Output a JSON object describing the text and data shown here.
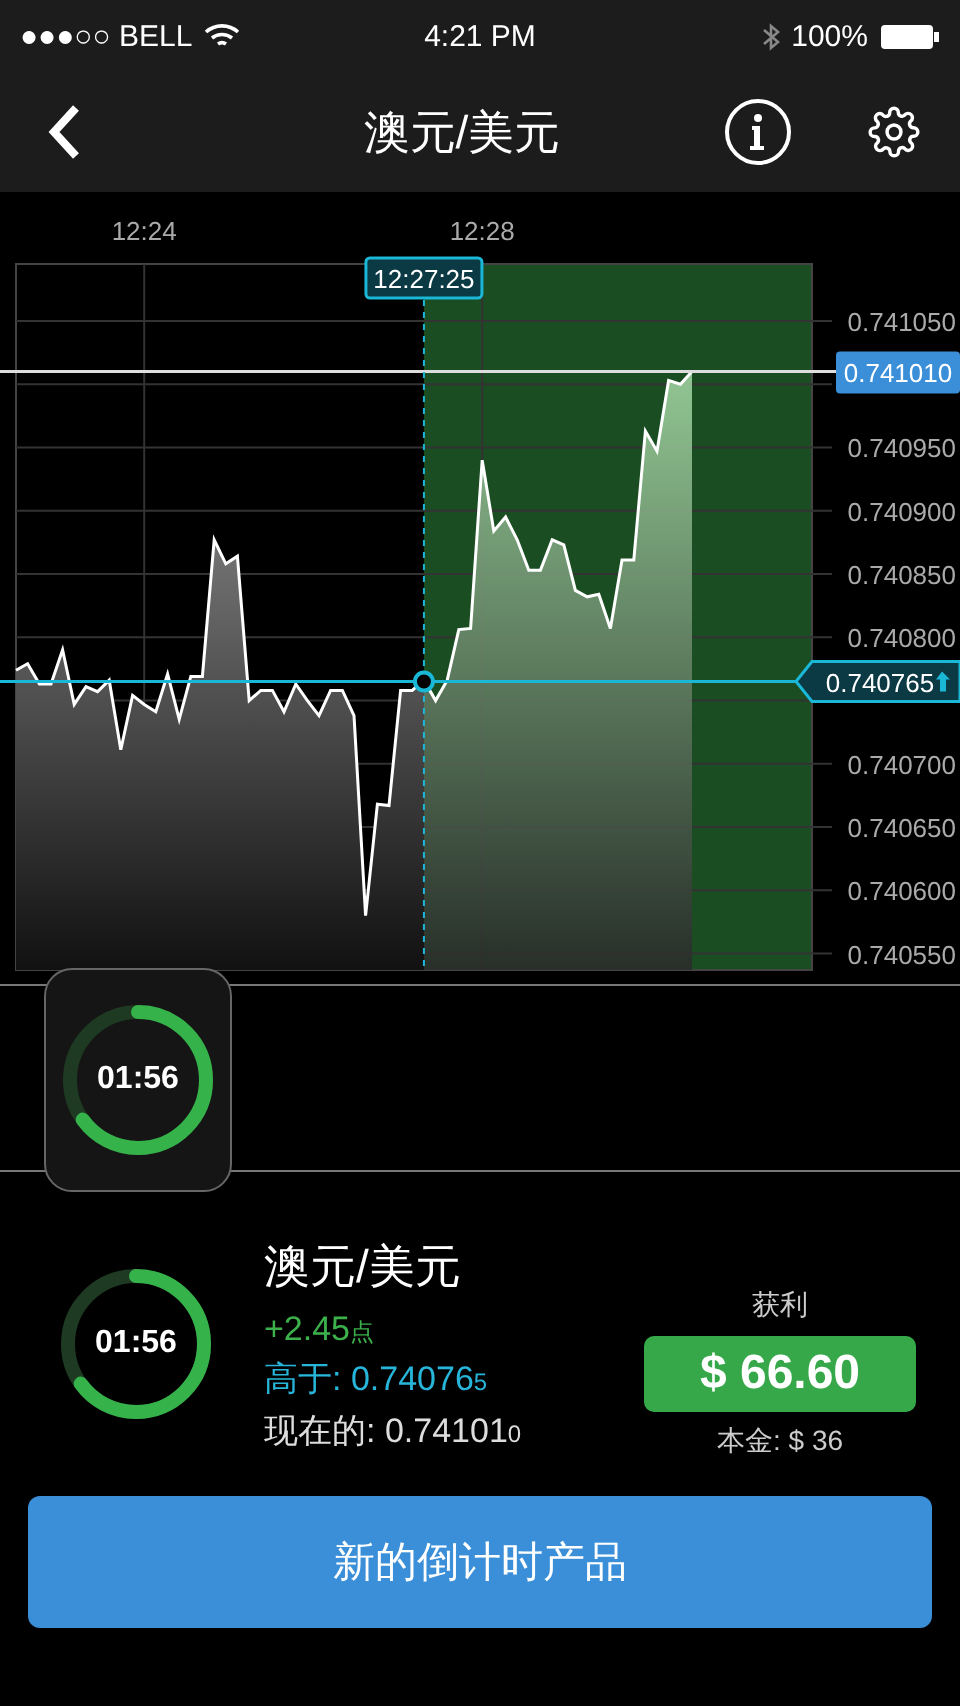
{
  "status_bar": {
    "carrier": "●●●○○ BELL",
    "time": "4:21 PM",
    "battery": "100%"
  },
  "nav": {
    "title": "澳元/美元"
  },
  "chart": {
    "marker_time": "12:27:25",
    "current_price": "0.741010",
    "strike_price": "0.740765",
    "chart_data": {
      "type": "area",
      "ylim": [
        0.740537,
        0.741095
      ],
      "grid": true,
      "ref_lines": [
        {
          "axis": "y",
          "value": 0.74101,
          "color": "#dddddd"
        },
        {
          "axis": "y",
          "value": 0.740765,
          "color": "#1bb7d6"
        }
      ],
      "categories": [
        null,
        null,
        null,
        null,
        null,
        null,
        null,
        null,
        null,
        null,
        null,
        "12:24",
        null,
        null,
        null,
        null,
        null,
        null,
        null,
        null,
        null,
        null,
        null,
        null,
        null,
        null,
        null,
        null,
        null,
        null,
        null,
        null,
        null,
        null,
        null,
        null,
        null,
        null,
        null,
        null,
        "12:28",
        null,
        null,
        null,
        null,
        null,
        null,
        null,
        null,
        null,
        null,
        null,
        null,
        null,
        null,
        null,
        null,
        null,
        null
      ],
      "yticks": [
        {
          "value": 0.74105,
          "label": "0.741050"
        },
        {
          "value": 0.74095,
          "label": "0.740950"
        },
        {
          "value": 0.7409,
          "label": "0.740900"
        },
        {
          "value": 0.74085,
          "label": "0.740850"
        },
        {
          "value": 0.7408,
          "label": "0.740800"
        },
        {
          "value": 0.7407,
          "label": "0.740700"
        },
        {
          "value": 0.74065,
          "label": "0.740650"
        },
        {
          "value": 0.7406,
          "label": "0.740600"
        },
        {
          "value": 0.74055,
          "label": "0.740550"
        }
      ],
      "series": [
        {
          "color": "#ffffff",
          "values": [
            0.740774,
            0.740779,
            0.740763,
            0.740763,
            0.74079,
            0.740747,
            0.740761,
            0.740757,
            0.740766,
            0.740711,
            0.740754,
            0.740747,
            0.740741,
            0.740771,
            0.740735,
            0.740769,
            0.740769,
            0.740877,
            0.740858,
            0.740864,
            0.74075,
            0.740758,
            0.740758,
            0.740741,
            0.740763,
            0.74075,
            0.740738,
            0.740758,
            0.740758,
            0.740738,
            0.74058,
            0.740668,
            0.740667,
            0.740758,
            0.740758,
            0.740766,
            0.74075,
            0.740766,
            0.740806,
            0.740807,
            0.74094,
            0.740884,
            0.740895,
            0.740877,
            0.740853,
            0.740853,
            0.740877,
            0.740873,
            0.740837,
            0.740832,
            0.740834,
            0.740807,
            0.740861,
            0.740861,
            0.740963,
            0.740947,
            0.741003,
            0.741,
            0.74101
          ]
        }
      ]
    }
  },
  "timer_badge": {
    "time": "01:56"
  },
  "trade": {
    "time": "01:56",
    "pair": "澳元/美元",
    "change": "+2.45",
    "change_unit": "点",
    "strike_label": "高于:",
    "strike_main": "0.74076",
    "strike_pip": "5",
    "current_label": "现在的:",
    "current_main": "0.74101",
    "current_pip": "0",
    "profit_label": "获利",
    "profit": "$ 66.60",
    "principal": "本金: $ 36"
  },
  "action_button": "新的倒计时产品"
}
